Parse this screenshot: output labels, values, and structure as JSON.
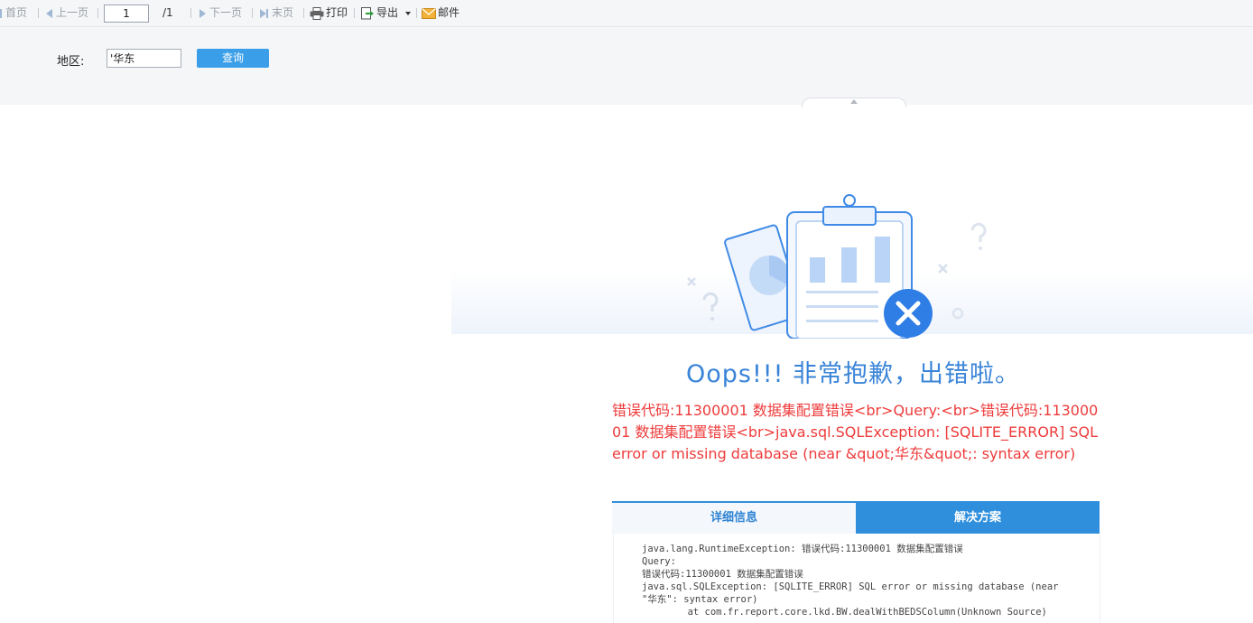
{
  "toolbar": {
    "first": "首页",
    "prev": "上一页",
    "page_value": "1",
    "page_total": "/1",
    "next": "下一页",
    "last": "末页",
    "print": "打印",
    "export": "导出",
    "email": "邮件"
  },
  "params": {
    "region_label": "地区:",
    "region_value": "'华东",
    "query_button": "查询"
  },
  "error": {
    "title": "Oops!!! 非常抱歉，出错啦。",
    "message": "错误代码:11300001 数据集配置错误<br>Query:<br>错误代码:11300001 数据集配置错误<br>java.sql.SQLException: [SQLITE_ERROR] SQL error or missing database (near &quot;华东&quot;: syntax error)",
    "tab_detail": "详细信息",
    "tab_solution": "解决方案",
    "detail_lines": [
      "java.lang.RuntimeException: 错误代码:11300001 数据集配置错误",
      "Query:",
      "错误代码:11300001 数据集配置错误",
      "java.sql.SQLException: [SQLITE_ERROR] SQL error or missing database (near \"华东\": syntax error)",
      "        at com.fr.report.core.lkd.BW.dealWithBEDSColumn(Unknown Source)"
    ]
  },
  "colors": {
    "accent": "#2f8fdc",
    "title": "#3a84d8",
    "error_text": "#ee3b3b",
    "error_badge": "#2f7ee6"
  },
  "icons": {
    "first": "first-page-icon",
    "prev": "prev-page-icon",
    "next": "next-page-icon",
    "last": "last-page-icon",
    "print": "printer-icon",
    "export": "export-icon",
    "email": "envelope-icon",
    "error": "error-x-icon"
  }
}
